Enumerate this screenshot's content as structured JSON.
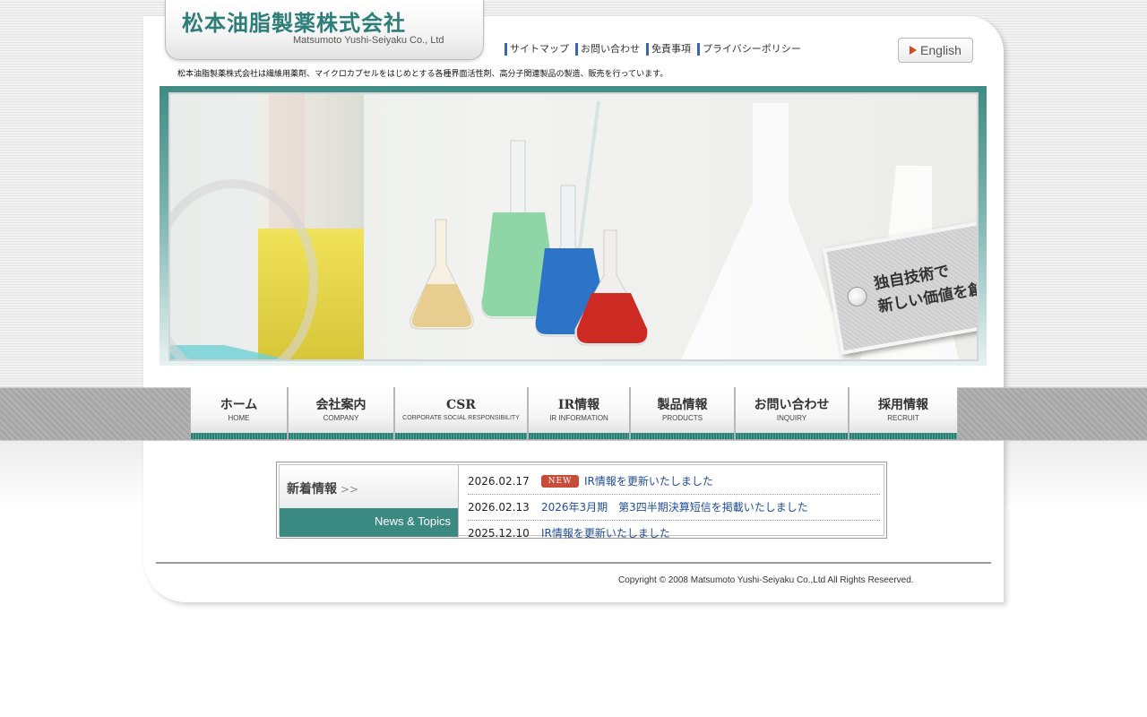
{
  "header": {
    "logo_jp": "松本油脂製薬株式会社",
    "logo_en": "Matsumoto Yushi-Seiyaku Co., Ltd",
    "util_links": [
      "サイトマップ",
      "お問い合わせ",
      "免責事項",
      "プライバシーポリシー"
    ],
    "english_label": "English",
    "tagline": "松本油脂製薬株式会社は繊維用薬剤、マイクロカプセルをはじめとする各種界面活性剤、高分子関連製品の製造、販売を行っています。"
  },
  "hero": {
    "line1": "独自技術で",
    "line2": "新しい価値を創造し続けます。"
  },
  "nav": [
    {
      "jp": "ホーム",
      "en": "HOME"
    },
    {
      "jp": "会社案内",
      "en": "COMPANY"
    },
    {
      "jp": "CSR",
      "en": "CORPORATE SOCIAL RESPONSIBILITY"
    },
    {
      "jp": "IR情報",
      "en": "IR INFORMATION"
    },
    {
      "jp": "製品情報",
      "en": "PRODUCTS"
    },
    {
      "jp": "お問い合わせ",
      "en": "INQUIRY"
    },
    {
      "jp": "採用情報",
      "en": "RECRUIT"
    }
  ],
  "news": {
    "title": "新着情報",
    "chevron": ">>",
    "subtitle": "News & Topics",
    "new_badge": "NEW",
    "items": [
      {
        "date": "2026.02.17",
        "text": "IR情報を更新いたしました"
      },
      {
        "date": "2026.02.13",
        "text": "2026年3月期　第3四半期決算短信を掲載いたしました"
      },
      {
        "date": "2025.12.10",
        "text": "IR情報を更新いたしました"
      }
    ]
  },
  "footer": {
    "copyright": "Copyright © 2008 Matsumoto Yushi-Seiyaku Co.,Ltd All Rights Reseerved."
  },
  "colors": {
    "brand_teal": "#2e7e78",
    "link_blue": "#1f4c9a",
    "new_badge_red": "#c94b3a"
  }
}
